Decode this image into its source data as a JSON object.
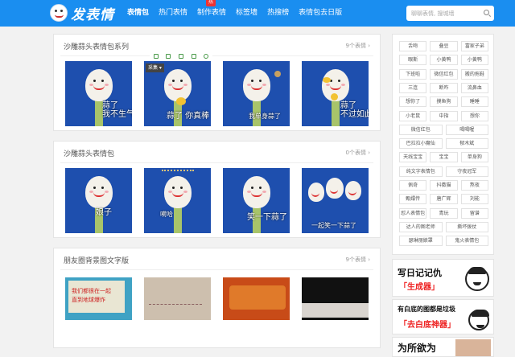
{
  "header": {
    "brand": "发表情",
    "nav": [
      "表情包",
      "热门表情",
      "制作表情",
      "标签墙",
      "热搜榜",
      "表情包去日版"
    ],
    "hot_badge": "热",
    "search_placeholder": "聊聊表情, 搜城墙",
    "colors": {
      "topbar": "#1a8ef0",
      "hot": "#e33333"
    }
  },
  "sections": [
    {
      "title": "沙雕蒜头表情包系列",
      "count": "9个表情 ›",
      "items": [
        {
          "caption": "蒜了\n我不生气"
        },
        {
          "caption": "蒜了 你真棒"
        },
        {
          "caption": "我单身蒜了"
        },
        {
          "caption": "蒜了\n不过如此"
        }
      ]
    },
    {
      "title": "沙雕蒜头表情包",
      "count": "0个表情 ›",
      "items": [
        {
          "caption": "娘子"
        },
        {
          "caption": "嗬哈"
        },
        {
          "caption": "笑一下蒜了"
        },
        {
          "caption": "一起笑一下蒜了"
        }
      ]
    },
    {
      "title": "朋友圈背景图文字版",
      "count": "9个表情 ›",
      "items": [
        {
          "caption": "我们都很在一起\n直到地球爆炸"
        },
        {
          "caption": ""
        },
        {
          "caption": ""
        },
        {
          "caption": ""
        }
      ]
    }
  ],
  "hover_toolbar": {
    "icons": [
      "crop-icon",
      "expand-icon",
      "image-icon",
      "share-icon",
      "settings-icon"
    ],
    "collect_label": "采集 ▾"
  },
  "sidebar": {
    "tags": [
      [
        "舌吻",
        "叠豆",
        "富家子弟"
      ],
      [
        "眼斯",
        "小黄鸭",
        "小黄鸭"
      ],
      [
        "下班啦",
        "微信红包",
        "搬的拖鞋"
      ],
      [
        "三连",
        "断咋",
        "流鼻血"
      ],
      [
        "想你了",
        "摸鱼狗",
        "睡睡"
      ],
      [
        "小老鼠",
        "中指",
        "想你"
      ],
      [
        "微信红包",
        "喝喝喔"
      ],
      [
        "巴拉拉小魔仙",
        "郁木斌"
      ],
      [
        "天线宝宝",
        "宝宝",
        "单身狗"
      ],
      [
        "纯文字表情包",
        "守夜冠军"
      ],
      [
        "佩奇",
        "抖擞猫",
        "熬夜"
      ],
      [
        "甄嬛传",
        "唐广辉",
        "刘能"
      ],
      [
        "怼人表情包",
        "青玩",
        "留谱"
      ],
      [
        "达人的图老师",
        "撕坏拨仗"
      ],
      [
        "瑟琳丽娘罩",
        "鬼火表情包"
      ]
    ]
  },
  "ads": [
    {
      "line1": "写日记记仇",
      "line2": "「生成器」"
    },
    {
      "line1": "有白底的图都是垃圾",
      "line2": "「去白底神器」"
    },
    {
      "line1": "为所欲为",
      "line2": ""
    }
  ]
}
